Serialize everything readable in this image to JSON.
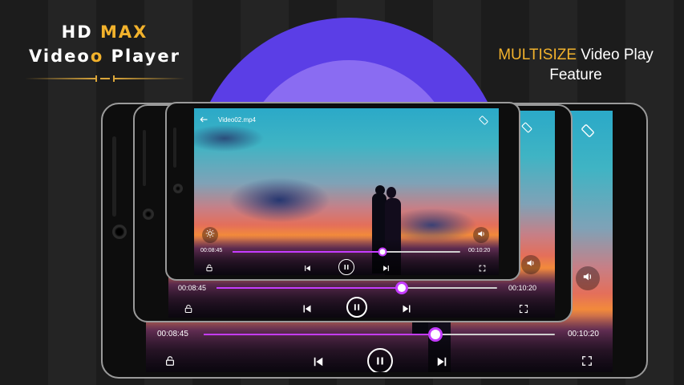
{
  "branding": {
    "line1_part1": "HD ",
    "line1_part2": "MAX",
    "line2_part1": "Video",
    "line2_part2": "o",
    "line2_part3": " Player"
  },
  "headline": {
    "highlight": "MULTISIZE",
    "rest": " Video Play",
    "line2": "Feature"
  },
  "player": {
    "title": "Video02.mp4",
    "current_time": "00:08:45",
    "total_time": "00:10:20",
    "progress": 0.66
  },
  "icons": {
    "back": "arrow-left-icon",
    "rotate": "rotate-screen-icon",
    "brightness": "brightness-icon",
    "volume": "volume-icon",
    "lock": "lock-open-icon",
    "prev": "skip-previous-icon",
    "pause": "pause-icon",
    "next": "skip-next-icon",
    "fullscreen": "fullscreen-icon"
  },
  "colors": {
    "accent": "#c53cff",
    "gold": "#f2b22c",
    "circle_outer": "#5b3ee6",
    "circle_inner": "#8a6cf2"
  }
}
